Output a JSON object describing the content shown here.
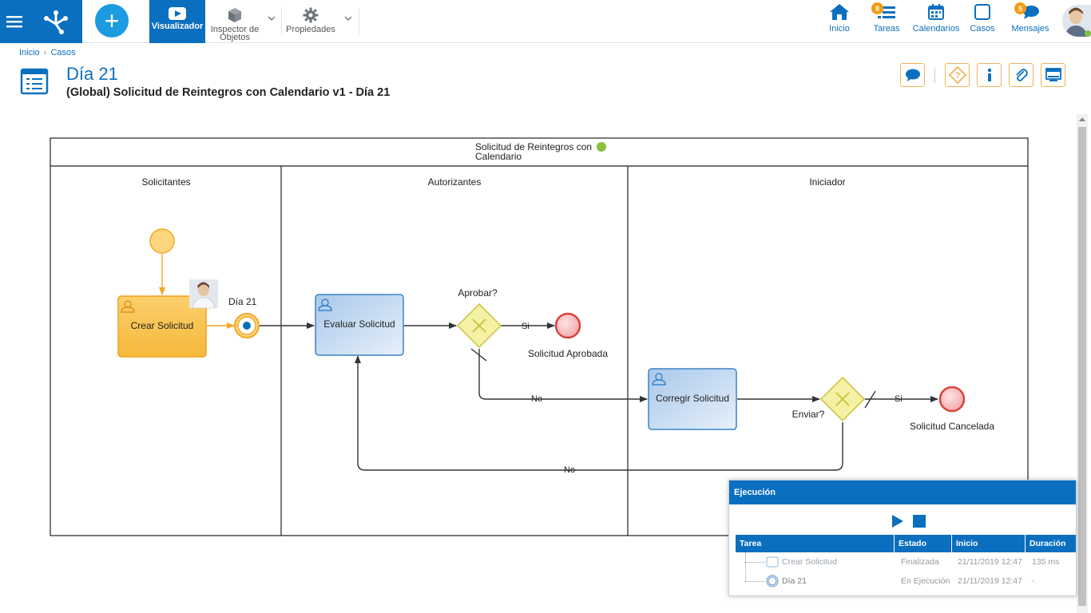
{
  "topbar": {
    "tools": {
      "visualizador": "Visualizador",
      "inspector_line1": "Inspector de",
      "inspector_line2": "Objetos",
      "propiedades": "Propiedades"
    },
    "nav": {
      "inicio": "Inicio",
      "tareas": "Tareas",
      "tareas_badge": "8",
      "calendarios": "Calendarios",
      "casos": "Casos",
      "mensajes": "Mensajes",
      "mensajes_badge": "5"
    }
  },
  "breadcrumb": {
    "home": "Inicio",
    "separator": "›",
    "current": "Casos"
  },
  "header": {
    "title": "Día 21",
    "subtitle": "(Global) Solicitud de Reintegros con Calendario v1 - Día 21"
  },
  "diagram": {
    "pool_title_line1": "Solicitud de Reintegros con",
    "pool_title_line2": "Calendario",
    "lanes": [
      "Solicitantes",
      "Autorizantes",
      "Iniciador"
    ],
    "tasks": {
      "crear": "Crear Solicitud",
      "evaluar": "Evaluar Solicitud",
      "corregir": "Corregir Solicitud"
    },
    "timer_label": "Día 21",
    "gateways": {
      "aprobar": "Aprobar?",
      "enviar": "Enviar?"
    },
    "flow_labels": {
      "si": "Si",
      "no": "No"
    },
    "end_events": {
      "aprobada": "Solicitud Aprobada",
      "cancelada": "Solicitud Cancelada"
    },
    "colors": {
      "active": "#f8c04a",
      "task_blue": "#c9ddf2",
      "gateway": "#f4f1a4",
      "end": "#f2b8b8"
    }
  },
  "execution": {
    "title": "Ejecución",
    "columns": [
      "Tarea",
      "Estado",
      "Inicio",
      "Duración"
    ],
    "rows": [
      {
        "task": "Crear Solicitud",
        "state": "Finalizada",
        "start": "21/11/2019 12:47",
        "duration": "135 ms"
      },
      {
        "task": "Día 21",
        "state": "En Ejecución",
        "start": "21/11/2019 12:47",
        "duration": "-"
      }
    ]
  }
}
